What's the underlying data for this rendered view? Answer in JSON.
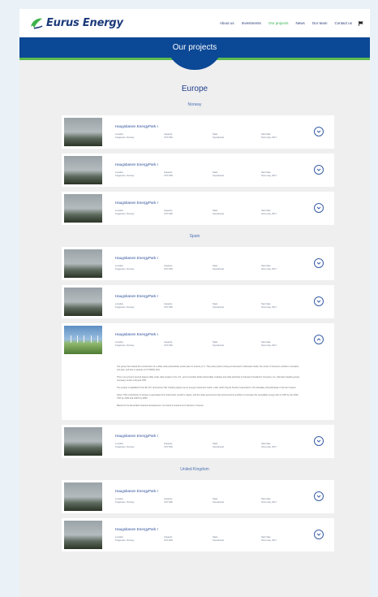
{
  "header": {
    "brand": "Eurus Energy",
    "nav": [
      "About us",
      "Investments",
      "Our projects",
      "News",
      "Our team",
      "Contact us"
    ],
    "active_nav": "Our projects",
    "accent_green": "#34b24a",
    "brand_blue": "#0b4896"
  },
  "banner": {
    "title": "Our projects"
  },
  "region": "Europe",
  "labels": {
    "location": "Location",
    "capacity": "Capacity",
    "state": "State",
    "start_date": "Start date"
  },
  "project": {
    "name": "Haugsbanen EnergyPark I",
    "location": "Kragerøen, Norway",
    "capacity": "XXX MW",
    "state": "Operational",
    "start_date": "Since day, 2017"
  },
  "countries": [
    {
      "name": "Norway",
      "cards": 3
    },
    {
      "name": "Spain",
      "cards": 4,
      "expanded_index": 2
    },
    {
      "name": "United Kingdom",
      "cards": 2
    }
  ],
  "description": [
    "Our group has started the construction of a utility scale photovoltaic power plant in Greece (L.C. The power plant is being constructed in Kleinastin Gödi), the center of Greece's northern mountains and grid, and has a capacity of 47.6MWp (AC).",
    "This is our group's second largest utility scale solar project in the U.S., and it provides Solar photovoltaic modules and sells electricity to Kansas City Electric Company, Inc. (Kansas's leading power company) under a 20-year PPA.",
    "The project is qualified for the EU ITC (Investment Tax Credit) program as an energy investment credit, under which Toyota Tsusho Corporation's US subsidiary will participate in the tax investor.",
    "About 70% of electricity in Greece is generated from fossil fuels, similar to Japan, and the state government has announced its ambition to increase the renewable energy ratio to 33% by the 2020, 70% by 2030 and 100% by 2050.",
    "Based on the favourable business development, we intend to expand our business in Greece."
  ]
}
